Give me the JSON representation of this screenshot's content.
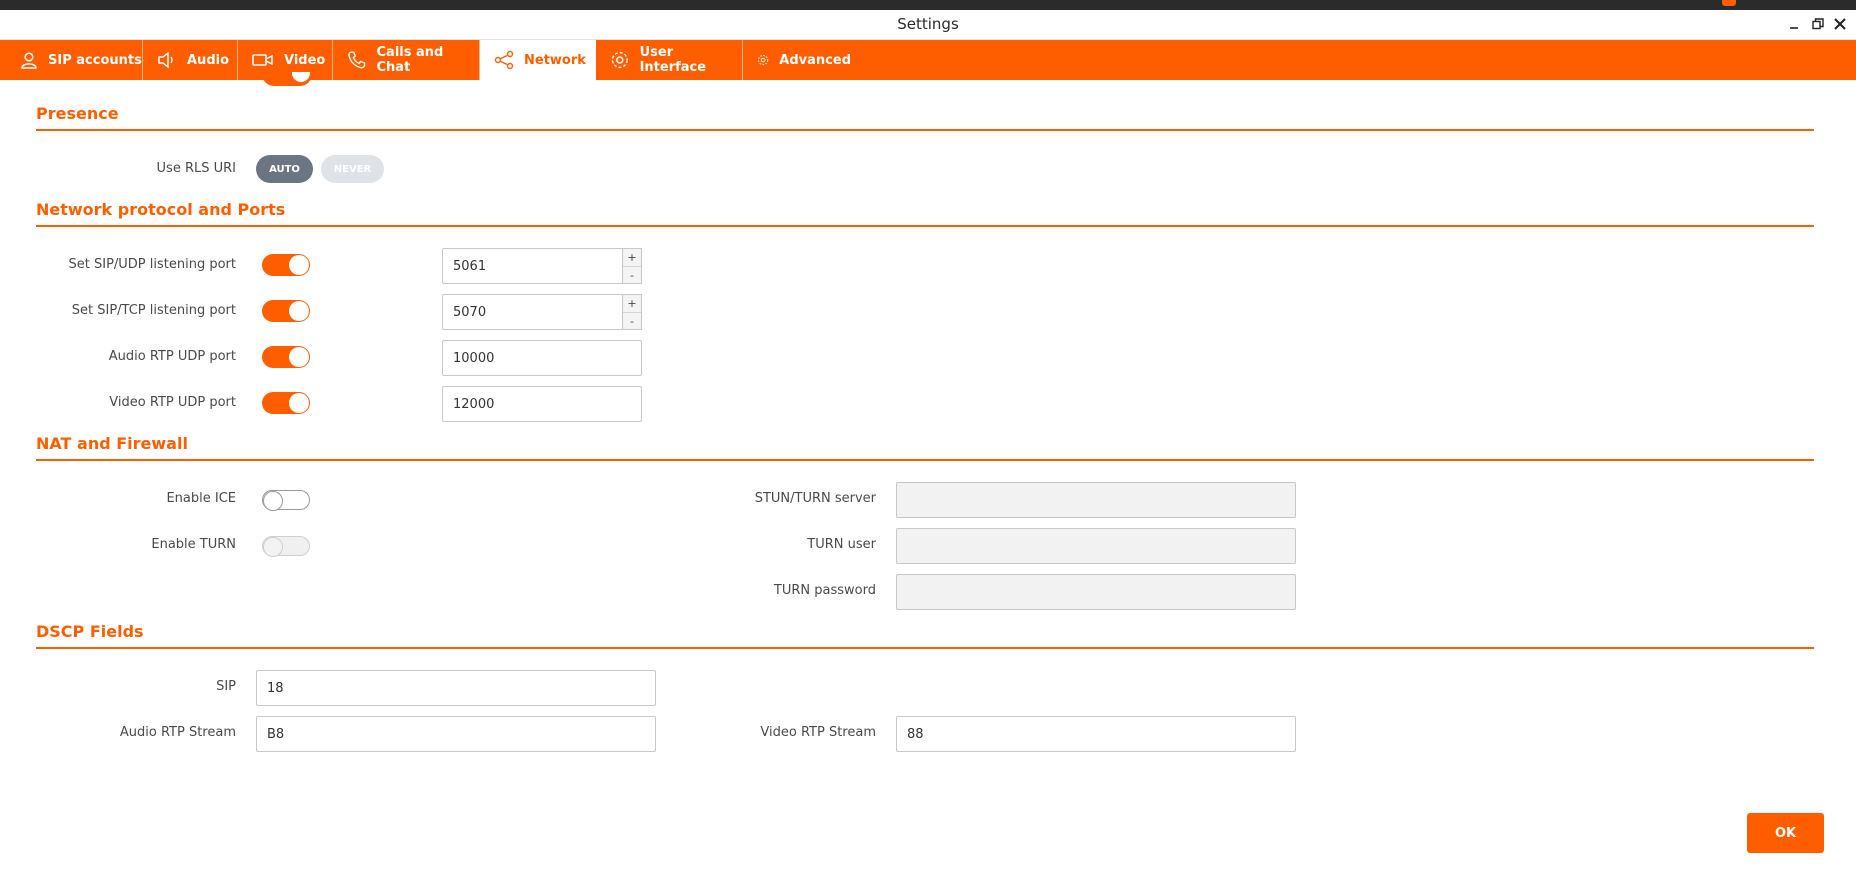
{
  "window": {
    "title": "Settings"
  },
  "tabs": [
    {
      "label": "SIP accounts",
      "icon": "user-icon"
    },
    {
      "label": "Audio",
      "icon": "speaker-icon"
    },
    {
      "label": "Video",
      "icon": "camera-icon"
    },
    {
      "label": "Calls and Chat",
      "icon": "phone-icon"
    },
    {
      "label": "Network",
      "icon": "share-icon",
      "active": true
    },
    {
      "label": "User Interface",
      "icon": "gear-icon"
    },
    {
      "label": "Advanced",
      "icon": "gear-icon"
    }
  ],
  "presence": {
    "title": "Presence",
    "rls_label": "Use RLS URI",
    "auto_label": "AUTO",
    "never_label": "NEVER",
    "selected": "AUTO"
  },
  "network": {
    "title": "Network protocol and Ports",
    "rows": [
      {
        "label": "Set SIP/UDP listening port",
        "enabled": true,
        "value": "5061",
        "spinner": true
      },
      {
        "label": "Set SIP/TCP listening port",
        "enabled": true,
        "value": "5070",
        "spinner": true
      },
      {
        "label": "Audio RTP UDP port",
        "enabled": true,
        "value": "10000",
        "spinner": false
      },
      {
        "label": "Video RTP UDP port",
        "enabled": true,
        "value": "12000",
        "spinner": false
      }
    ],
    "spin_up": "+",
    "spin_down": "-"
  },
  "nat": {
    "title": "NAT and Firewall",
    "enable_ice_label": "Enable ICE",
    "enable_ice": false,
    "enable_turn_label": "Enable TURN",
    "enable_turn": false,
    "stun_label": "STUN/TURN server",
    "stun_value": "",
    "turn_user_label": "TURN user",
    "turn_user_value": "",
    "turn_password_label": "TURN password",
    "turn_password_value": ""
  },
  "dscp": {
    "title": "DSCP Fields",
    "sip_label": "SIP",
    "sip_value": "18",
    "audio_label": "Audio RTP Stream",
    "audio_value": "B8",
    "video_label": "Video RTP Stream",
    "video_value": "88"
  },
  "footer": {
    "ok_label": "OK"
  },
  "colors": {
    "accent": "#ff5e00",
    "selected_pill": "#6b7682",
    "unselected_pill": "#dfe3e8"
  }
}
